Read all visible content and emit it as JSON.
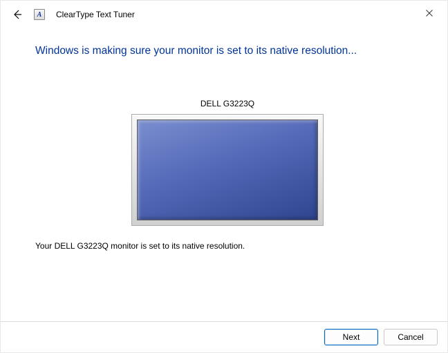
{
  "header": {
    "app_title": "ClearType Text Tuner",
    "app_icon_glyph": "A"
  },
  "main": {
    "heading": "Windows is making sure your monitor is set to its native resolution...",
    "monitor_name": "DELL G3223Q",
    "status_text": "Your DELL G3223Q monitor is set to its native resolution."
  },
  "footer": {
    "next_label": "Next",
    "cancel_label": "Cancel"
  }
}
